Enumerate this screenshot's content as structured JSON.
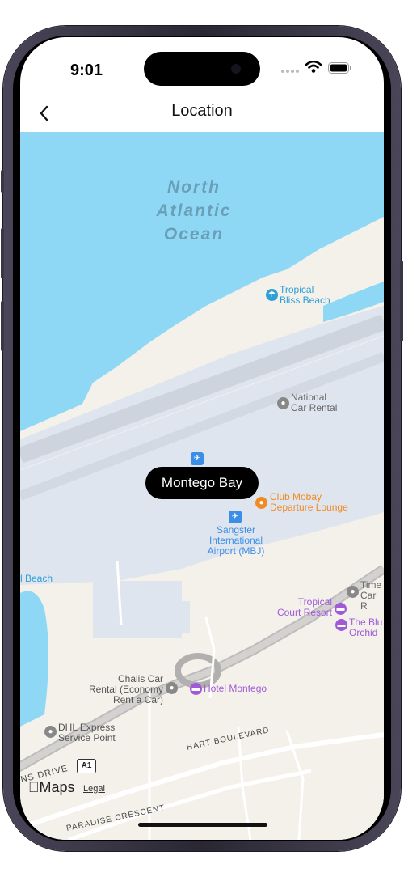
{
  "status_bar": {
    "time": "9:01"
  },
  "nav": {
    "title": "Location",
    "back_icon": "chevron-left-icon"
  },
  "map": {
    "ocean_label": [
      "North",
      "Atlantic",
      "Ocean"
    ],
    "city_label": "Montego Bay",
    "pois": {
      "tropical_bliss": [
        "Tropical",
        "Bliss Beach"
      ],
      "national_car": [
        "National",
        "Car Rental"
      ],
      "club_mobay": [
        "Club Mobay",
        "Departure Lounge"
      ],
      "sangster": [
        "Sangster",
        "International",
        "Airport (MBJ)"
      ],
      "beach_left": "l Beach",
      "times_car": [
        "Time",
        "Car R"
      ],
      "tropical_court": [
        "Tropical",
        "Court Resort"
      ],
      "blue_orchid": [
        "The Blu",
        "Orchid"
      ],
      "chalis": [
        "Chalis Car",
        "Rental (Economy",
        "Rent a Car)"
      ],
      "hotel_montego": "Hotel Montego",
      "dhl": [
        "DHL Express",
        "Service Point"
      ]
    },
    "roads": {
      "hart": "HART BOULEVARD",
      "ns_drive": "NS DRIVE",
      "paradise": "PARADISE CRESCENT",
      "route_shield": "A1"
    },
    "attribution": {
      "maps": "Maps",
      "legal": "Legal"
    }
  },
  "colors": {
    "water": "#8fd8f5",
    "land": "#f3f1ea",
    "airport": "#dfe5ee",
    "poi_blue": "#2e9fd8",
    "poi_orange": "#f08a24",
    "poi_purple": "#a05ad8"
  }
}
